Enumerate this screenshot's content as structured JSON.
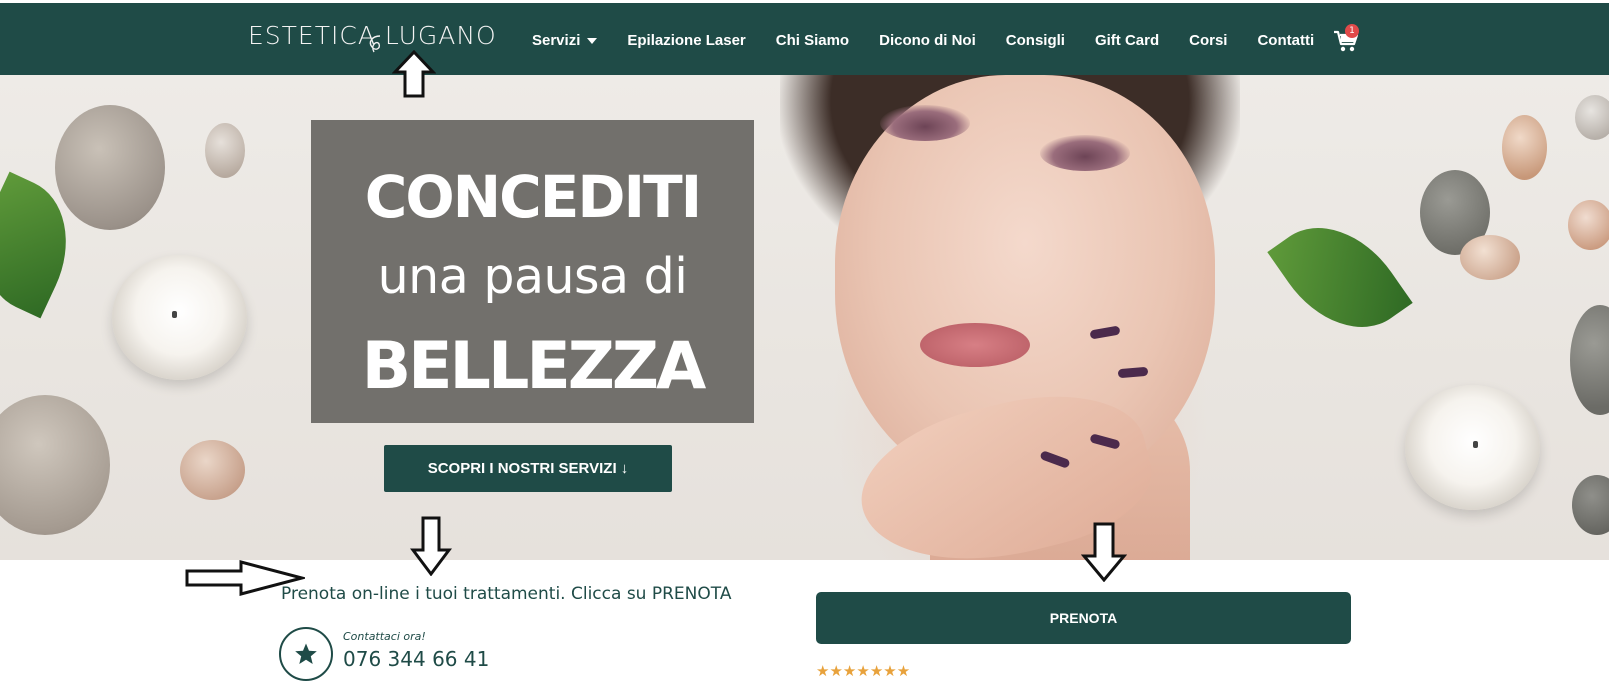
{
  "header": {
    "logo_text": "ESTETICA LUGANO",
    "nav": [
      {
        "label": "Servizi",
        "has_dropdown": true
      },
      {
        "label": "Epilazione Laser"
      },
      {
        "label": "Chi Siamo"
      },
      {
        "label": "Dicono di Noi"
      },
      {
        "label": "Consigli"
      },
      {
        "label": "Gift Card"
      },
      {
        "label": "Corsi"
      },
      {
        "label": "Contatti"
      }
    ],
    "cart_icon": "cart-icon",
    "cart_count": "1"
  },
  "hero": {
    "line1": "CONCEDITI",
    "line2": "una pausa di",
    "line3": "BELLEZZA",
    "cta_label": "SCOPRI I NOSTRI SERVIZI ↓"
  },
  "booking": {
    "text": "Prenota on-line i tuoi trattamenti. Clicca su PRENOTA",
    "contact_label": "Contattaci ora!",
    "phone": "076 344 66 41",
    "contact_icon": "star-icon",
    "button_label": "PRENOTA",
    "rating_stars": 7
  },
  "colors": {
    "brand": "#1f4b47",
    "badge": "#e04a4a",
    "stars": "#e8a23c"
  }
}
